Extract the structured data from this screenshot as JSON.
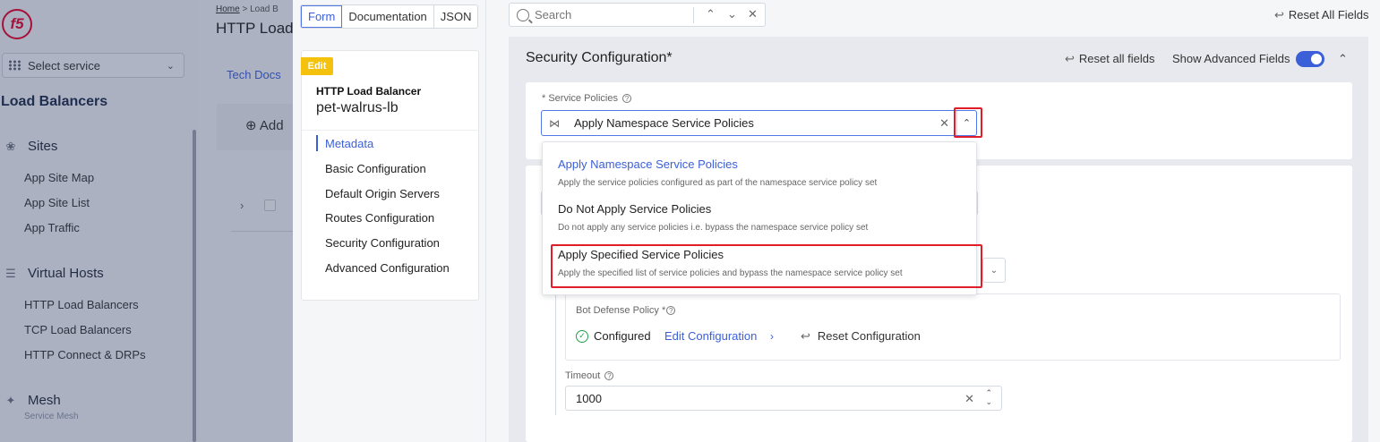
{
  "app": {
    "logo_text": "f5",
    "select_service": "Select service",
    "section_title": "Load Balancers",
    "groups": [
      {
        "label": "Sites",
        "items": [
          "App Site Map",
          "App Site List",
          "App Traffic"
        ]
      },
      {
        "label": "Virtual Hosts",
        "items": [
          "HTTP Load Balancers",
          "TCP Load Balancers",
          "HTTP Connect & DRPs"
        ]
      },
      {
        "label": "Mesh",
        "sub": "Service Mesh"
      }
    ]
  },
  "page": {
    "breadcrumb_home": "Home",
    "breadcrumb_sep": ">",
    "breadcrumb_next": "Load B",
    "title": "HTTP Load",
    "tech_docs": "Tech Docs",
    "add_label": "Add"
  },
  "drawer": {
    "tabs": [
      "Form",
      "Documentation",
      "JSON"
    ],
    "edit_badge": "Edit",
    "object_type": "HTTP Load Balancer",
    "object_name": "pet-walrus-lb",
    "nav": [
      "Metadata",
      "Basic Configuration",
      "Default Origin Servers",
      "Routes Configuration",
      "Security Configuration",
      "Advanced Configuration"
    ],
    "search_placeholder": "Search",
    "reset_all_fields_top": "Reset All Fields"
  },
  "section": {
    "title": "Security Configuration*",
    "reset_all_fields": "Reset all fields",
    "show_advanced_fields": "Show Advanced Fields",
    "show_advanced_enabled": true,
    "service_policies_label": "* Service Policies",
    "service_policies_value": "Apply Namespace Service Policies",
    "options": [
      {
        "title": "Apply Namespace Service Policies",
        "desc": "Apply the service policies configured as part of the namespace service policy set"
      },
      {
        "title": "Do Not Apply Service Policies",
        "desc": "Do not apply any service policies i.e. bypass the namespace service policy set"
      },
      {
        "title": "Apply Specified Service Policies",
        "desc": "Apply the specified list of service policies and bypass the namespace service policy set"
      }
    ],
    "bot_defense_label": "Bot Defense Policy *",
    "configured": "Configured",
    "edit_configuration": "Edit Configuration",
    "reset_configuration": "Reset Configuration",
    "timeout_label": "Timeout",
    "timeout_value": "1000"
  },
  "colors": {
    "accent": "#3b5fd9",
    "highlight": "#e11d2a",
    "badge": "#f4c20d",
    "success": "#22a04b"
  }
}
